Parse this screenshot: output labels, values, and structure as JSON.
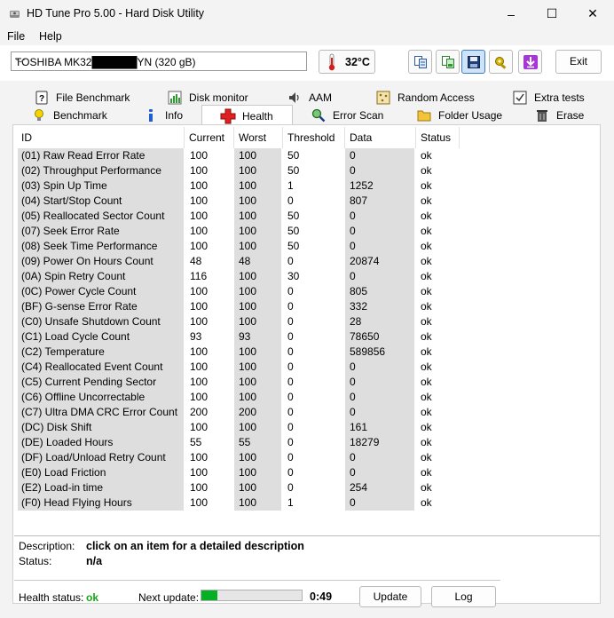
{
  "window": {
    "title": "HD Tune Pro 5.00 - Hard Disk Utility",
    "minimize": "–",
    "maximize": "☐",
    "close": "✕"
  },
  "menu": {
    "file": "File",
    "help": "Help"
  },
  "toolbar": {
    "drive": "TOSHIBA MK32██████YN       (320 gB)",
    "temperature": "32°C",
    "exit": "Exit",
    "icons": [
      "copy-text-icon",
      "copy-screenshot-icon",
      "save-icon",
      "options-icon",
      "download-icon"
    ]
  },
  "tabs": {
    "row1": [
      {
        "label": "File Benchmark",
        "icon": "file-benchmark-icon"
      },
      {
        "label": "Disk monitor",
        "icon": "disk-monitor-icon"
      },
      {
        "label": "AAM",
        "icon": "speaker-icon"
      },
      {
        "label": "Random Access",
        "icon": "random-access-icon"
      },
      {
        "label": "Extra tests",
        "icon": "extra-tests-icon"
      }
    ],
    "row2": [
      {
        "label": "Benchmark",
        "icon": "benchmark-icon"
      },
      {
        "label": "Info",
        "icon": "info-icon"
      },
      {
        "label": "Health",
        "icon": "health-cross-icon"
      },
      {
        "label": "Error Scan",
        "icon": "magnifier-icon"
      },
      {
        "label": "Folder Usage",
        "icon": "folder-icon"
      },
      {
        "label": "Erase",
        "icon": "trash-icon"
      }
    ],
    "active": "Health"
  },
  "table": {
    "headers": [
      "ID",
      "Current",
      "Worst",
      "Threshold",
      "Data",
      "Status"
    ],
    "rows": [
      [
        "(01) Raw Read Error Rate",
        "100",
        "100",
        "50",
        "0",
        "ok"
      ],
      [
        "(02) Throughput Performance",
        "100",
        "100",
        "50",
        "0",
        "ok"
      ],
      [
        "(03) Spin Up Time",
        "100",
        "100",
        "1",
        "1252",
        "ok"
      ],
      [
        "(04) Start/Stop Count",
        "100",
        "100",
        "0",
        "807",
        "ok"
      ],
      [
        "(05) Reallocated Sector Count",
        "100",
        "100",
        "50",
        "0",
        "ok"
      ],
      [
        "(07) Seek Error Rate",
        "100",
        "100",
        "50",
        "0",
        "ok"
      ],
      [
        "(08) Seek Time Performance",
        "100",
        "100",
        "50",
        "0",
        "ok"
      ],
      [
        "(09) Power On Hours Count",
        "48",
        "48",
        "0",
        "20874",
        "ok"
      ],
      [
        "(0A) Spin Retry Count",
        "116",
        "100",
        "30",
        "0",
        "ok"
      ],
      [
        "(0C) Power Cycle Count",
        "100",
        "100",
        "0",
        "805",
        "ok"
      ],
      [
        "(BF) G-sense Error Rate",
        "100",
        "100",
        "0",
        "332",
        "ok"
      ],
      [
        "(C0) Unsafe Shutdown Count",
        "100",
        "100",
        "0",
        "28",
        "ok"
      ],
      [
        "(C1) Load Cycle Count",
        "93",
        "93",
        "0",
        "78650",
        "ok"
      ],
      [
        "(C2) Temperature",
        "100",
        "100",
        "0",
        "589856",
        "ok"
      ],
      [
        "(C4) Reallocated Event Count",
        "100",
        "100",
        "0",
        "0",
        "ok"
      ],
      [
        "(C5) Current Pending Sector",
        "100",
        "100",
        "0",
        "0",
        "ok"
      ],
      [
        "(C6) Offline Uncorrectable",
        "100",
        "100",
        "0",
        "0",
        "ok"
      ],
      [
        "(C7) Ultra DMA CRC Error Count",
        "200",
        "200",
        "0",
        "0",
        "ok"
      ],
      [
        "(DC) Disk Shift",
        "100",
        "100",
        "0",
        "161",
        "ok"
      ],
      [
        "(DE) Loaded Hours",
        "55",
        "55",
        "0",
        "18279",
        "ok"
      ],
      [
        "(DF) Load/Unload Retry Count",
        "100",
        "100",
        "0",
        "0",
        "ok"
      ],
      [
        "(E0) Load Friction",
        "100",
        "100",
        "0",
        "0",
        "ok"
      ],
      [
        "(E2) Load-in time",
        "100",
        "100",
        "0",
        "254",
        "ok"
      ],
      [
        "(F0) Head Flying Hours",
        "100",
        "100",
        "1",
        "0",
        "ok"
      ]
    ]
  },
  "description": {
    "desc_label": "Description:",
    "desc_value": "click on an item for a detailed description",
    "status_label": "Status:",
    "status_value": "n/a"
  },
  "footer": {
    "health_label": "Health status:",
    "health_value": "ok",
    "health_color": "#14a814",
    "next_label": "Next update:",
    "progress_fraction": 0.16,
    "countdown": "0:49",
    "update_button": "Update",
    "log_button": "Log"
  }
}
